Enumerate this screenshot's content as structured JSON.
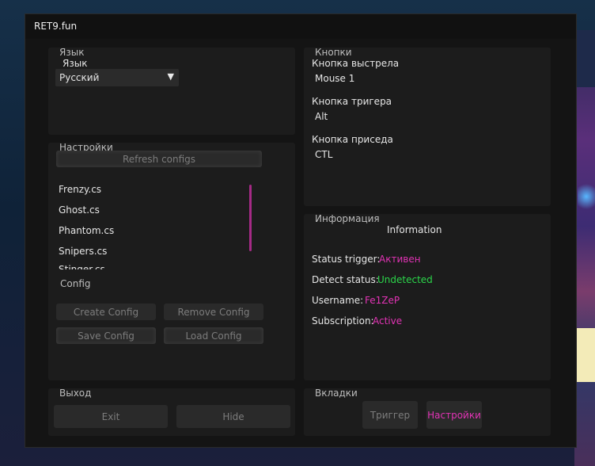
{
  "window": {
    "title": "RET9.fun"
  },
  "language": {
    "section_label": "Язык",
    "field_label": "Язык",
    "selected": "Русский",
    "arrow": "▼"
  },
  "settings": {
    "section_label": "Настройки",
    "refresh_label": "Refresh configs",
    "configs": [
      {
        "label": "Frenzy.cs",
        "selected": true
      },
      {
        "label": "Ghost.cs",
        "selected": false
      },
      {
        "label": "Phantom.cs",
        "selected": false
      },
      {
        "label": "Snipers.cs",
        "selected": false
      },
      {
        "label": "Stinger.cs",
        "selected": false
      }
    ],
    "config_label": "Config",
    "create_label": "Create Config",
    "remove_label": "Remove Config",
    "save_label": "Save Config",
    "load_label": "Load Config"
  },
  "exit": {
    "section_label": "Выход",
    "exit_label": "Exit",
    "hide_label": "Hide"
  },
  "buttons": {
    "section_label": "Кнопки",
    "shoot_label": "Кнопка выстрела",
    "shoot_value": "Mouse 1",
    "trigger_label": "Кнопка тригера",
    "trigger_value": "Alt",
    "crouch_label": "Кнопка приседа",
    "crouch_value": "CTL"
  },
  "info": {
    "section_label": "Информация",
    "heading": "Information",
    "status_trigger_label": "Status trigger:",
    "status_trigger_value": "Активен",
    "detect_status_label": "Detect status:",
    "detect_status_value": "Undetected",
    "username_label": "Username:",
    "username_value": "Fe1ZeP",
    "subscription_label": "Subscription:",
    "subscription_value": "Active"
  },
  "tabs": {
    "section_label": "Вкладки",
    "trigger_tab": "Триггер",
    "settings_tab": "Настройки"
  },
  "colors": {
    "accent_pink": "#e233b5",
    "status_green": "#2bd64a",
    "panel_bg": "#1c1c1c",
    "window_bg": "#141414"
  }
}
